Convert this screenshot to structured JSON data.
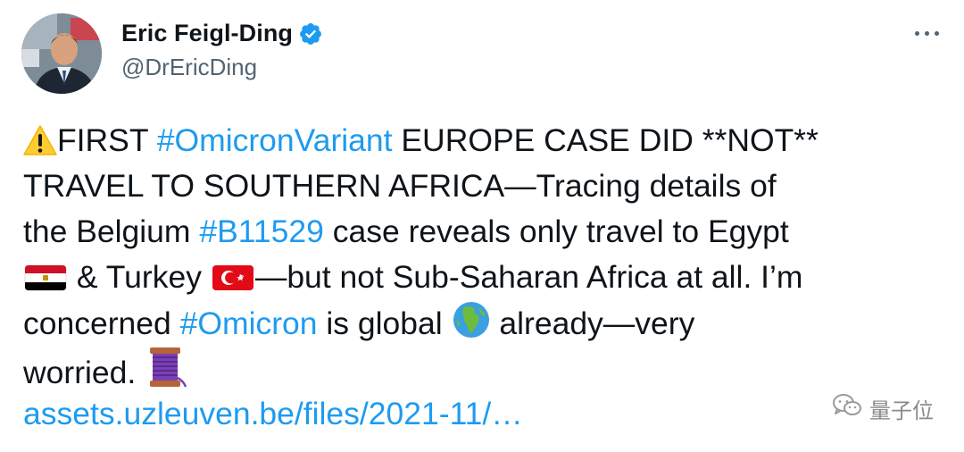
{
  "author": {
    "display_name": "Eric Feigl-Ding",
    "handle": "@DrEricDing",
    "avatar_alt": "Eric Feigl-Ding profile photo"
  },
  "tweet": {
    "line1": {
      "pre": "FIRST ",
      "hashtag": "#OmicronVariant",
      "post": " EUROPE CASE DID **NOT**"
    },
    "line2": "TRAVEL TO SOUTHERN AFRICA—Tracing details of",
    "line3": {
      "pre": "the Belgium ",
      "hashtag": "#B11529",
      "post": " case reveals only travel to Egypt"
    },
    "line4": {
      "a": " & Turkey ",
      "b": "—but not Sub-Saharan Africa at all. I’m"
    },
    "line5": {
      "pre": "concerned ",
      "hashtag": "#Omicron",
      "mid": " is global ",
      "post": " already—very"
    },
    "line6": "worried. ",
    "link": "assets.uzleuven.be/files/2021-11/…"
  },
  "watermark": {
    "text": "量子位"
  },
  "icons": {
    "warning": "warning-icon",
    "egypt_flag": "egypt-flag-icon",
    "turkey_flag": "turkey-flag-icon",
    "globe": "globe-africa-icon",
    "thread": "spool-of-thread-icon",
    "verified": "verified-badge-icon",
    "more": "more-options-icon"
  },
  "colors": {
    "link": "#1d9bf0",
    "text": "#0f1419",
    "secondary": "#536471",
    "verified": "#1d9bf0"
  }
}
